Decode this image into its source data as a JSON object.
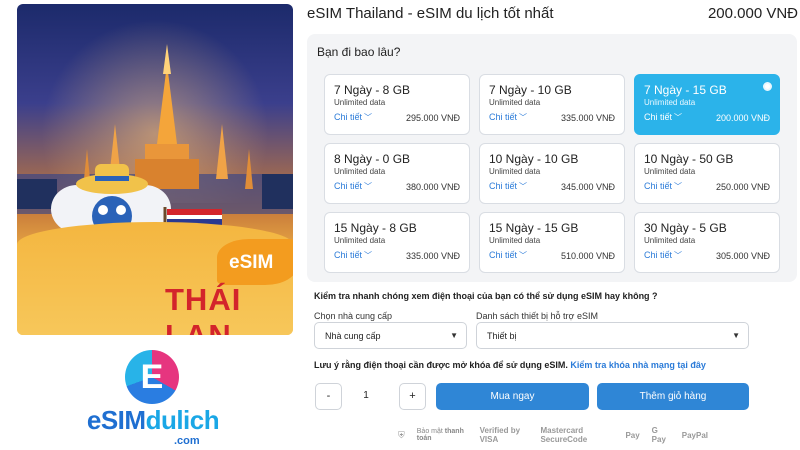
{
  "product": {
    "title": "eSIM Thailand - eSIM du lịch tốt nhất",
    "price": "200.000 VNĐ",
    "image_badge": "eSIM",
    "image_country": "THÁI LAN"
  },
  "brand": {
    "logo_letter": "E",
    "logo_main": "eSIM",
    "logo_accent": "dulich",
    "logo_domain": ".com"
  },
  "plans": {
    "question": "Bạn đi bao lâu?",
    "items": [
      {
        "name": "7 Ngày - 8 GB",
        "data": "Unlimited data",
        "detail": "Chi tiết",
        "price": "295.000 VNĐ",
        "selected": false
      },
      {
        "name": "7 Ngày - 10 GB",
        "data": "Unlimited data",
        "detail": "Chi tiết",
        "price": "335.000 VNĐ",
        "selected": false
      },
      {
        "name": "7 Ngày - 15 GB",
        "data": "Unlimited data",
        "detail": "Chi tiết",
        "price": "200.000 VNĐ",
        "selected": true
      },
      {
        "name": "8 Ngày - 0 GB",
        "data": "Unlimited data",
        "detail": "Chi tiết",
        "price": "380.000 VNĐ",
        "selected": false
      },
      {
        "name": "10 Ngày - 10 GB",
        "data": "Unlimited data",
        "detail": "Chi tiết",
        "price": "345.000 VNĐ",
        "selected": false
      },
      {
        "name": "10 Ngày - 50 GB",
        "data": "Unlimited data",
        "detail": "Chi tiết",
        "price": "250.000 VNĐ",
        "selected": false
      },
      {
        "name": "15 Ngày - 8 GB",
        "data": "Unlimited data",
        "detail": "Chi tiết",
        "price": "335.000 VNĐ",
        "selected": false
      },
      {
        "name": "15 Ngày - 15 GB",
        "data": "Unlimited data",
        "detail": "Chi tiết",
        "price": "510.000 VNĐ",
        "selected": false
      },
      {
        "name": "30 Ngày - 5 GB",
        "data": "Unlimited data",
        "detail": "Chi tiết",
        "price": "305.000 VNĐ",
        "selected": false
      }
    ]
  },
  "compat": {
    "heading": "Kiểm tra nhanh chóng xem điện thoại của bạn có thể sử dụng eSIM hay không ?",
    "carrier_label": "Chọn nhà cung cấp",
    "carrier_value": "Nhà cung cấp",
    "device_label": "Danh sách thiết bị hỗ trợ eSIM",
    "device_value": "Thiết bị",
    "note": "Lưu ý rằng điện thoại cần được mở khóa để sử dụng eSIM.",
    "note_link": "Kiểm tra khóa nhà mạng tại đây"
  },
  "purchase": {
    "minus": "-",
    "quantity": "1",
    "plus": "+",
    "buy_now": "Mua ngay",
    "add_to_cart": "Thêm giỏ hàng"
  },
  "payment": {
    "secure_text": "Bảo mật",
    "secure_strong": "thanh toán",
    "methods": [
      "Verified by VISA",
      "Mastercard SecureCode",
      "Pay",
      "G Pay",
      "PayPal"
    ]
  },
  "colors": {
    "selected_plan": "#2bb3ea",
    "primary_button": "#2f86d6",
    "link": "#2b7bd8",
    "country_text": "#d3242b"
  }
}
